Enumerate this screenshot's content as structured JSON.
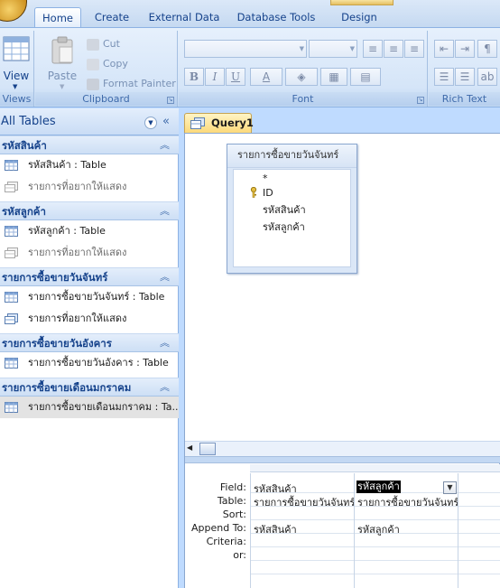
{
  "ribbon": {
    "tabs": [
      {
        "label": "Home",
        "active": true
      },
      {
        "label": "Create",
        "active": false
      },
      {
        "label": "External Data",
        "active": false
      },
      {
        "label": "Database Tools",
        "active": false
      },
      {
        "label": "Design",
        "active": false
      }
    ],
    "groups": {
      "views": {
        "label": "Views",
        "view_label": "View"
      },
      "clipboard": {
        "label": "Clipboard",
        "paste_label": "Paste",
        "cut_label": "Cut",
        "copy_label": "Copy",
        "format_painter_label": "Format Painter"
      },
      "font": {
        "label": "Font",
        "bold": "B",
        "italic": "I",
        "underline": "U",
        "font_color": "A"
      },
      "rich_text": {
        "label": "Rich Text"
      }
    }
  },
  "nav_pane": {
    "title": "All Tables",
    "groups": [
      {
        "header": "รหัสสินค้า",
        "items": [
          {
            "label": "รหัสสินค้า : Table",
            "kind": "table"
          },
          {
            "label": "รายการที่อยากให้แสดง",
            "kind": "query-dim"
          }
        ]
      },
      {
        "header": "รหัสลูกค้า",
        "items": [
          {
            "label": "รหัสลูกค้า : Table",
            "kind": "table"
          },
          {
            "label": "รายการที่อยากให้แสดง",
            "kind": "query-dim"
          }
        ]
      },
      {
        "header": "รายการซื้อขายวันจันทร์",
        "items": [
          {
            "label": "รายการซื้อขายวันจันทร์ : Table",
            "kind": "table"
          },
          {
            "label": "รายการที่อยากให้แสดง",
            "kind": "query"
          }
        ]
      },
      {
        "header": "รายการซื้อขายวันอังคาร",
        "items": [
          {
            "label": "รายการซื้อขายวันอังคาร : Table",
            "kind": "table"
          }
        ]
      },
      {
        "header": "รายการซื้อขายเดือนมกราคม",
        "items": [
          {
            "label": "รายการซื้อขายเดือนมกราคม : Ta...",
            "kind": "table",
            "selected": true
          }
        ]
      }
    ]
  },
  "document": {
    "tab_label": "Query1",
    "field_list": {
      "title": "รายการซื้อขายวันจันทร์",
      "fields": [
        "*",
        "ID",
        "รหัสสินค้า",
        "รหัสลูกค้า"
      ]
    },
    "grid": {
      "row_labels": [
        "Field:",
        "Table:",
        "Sort:",
        "Append To:",
        "Criteria:",
        "or:"
      ],
      "columns": [
        {
          "field": "รหัสสินค้า",
          "table": "รายการซื้อขายวันจันทร์",
          "append_to": "รหัสสินค้า"
        },
        {
          "field": "รหัสลูกค้า",
          "table": "รายการซื้อขายวันจันทร์",
          "append_to": "รหัสลูกค้า"
        }
      ]
    }
  },
  "colors": {
    "ribbon_text": "#15428b",
    "doc_background": "#bfdbff",
    "selection": "#000000"
  }
}
